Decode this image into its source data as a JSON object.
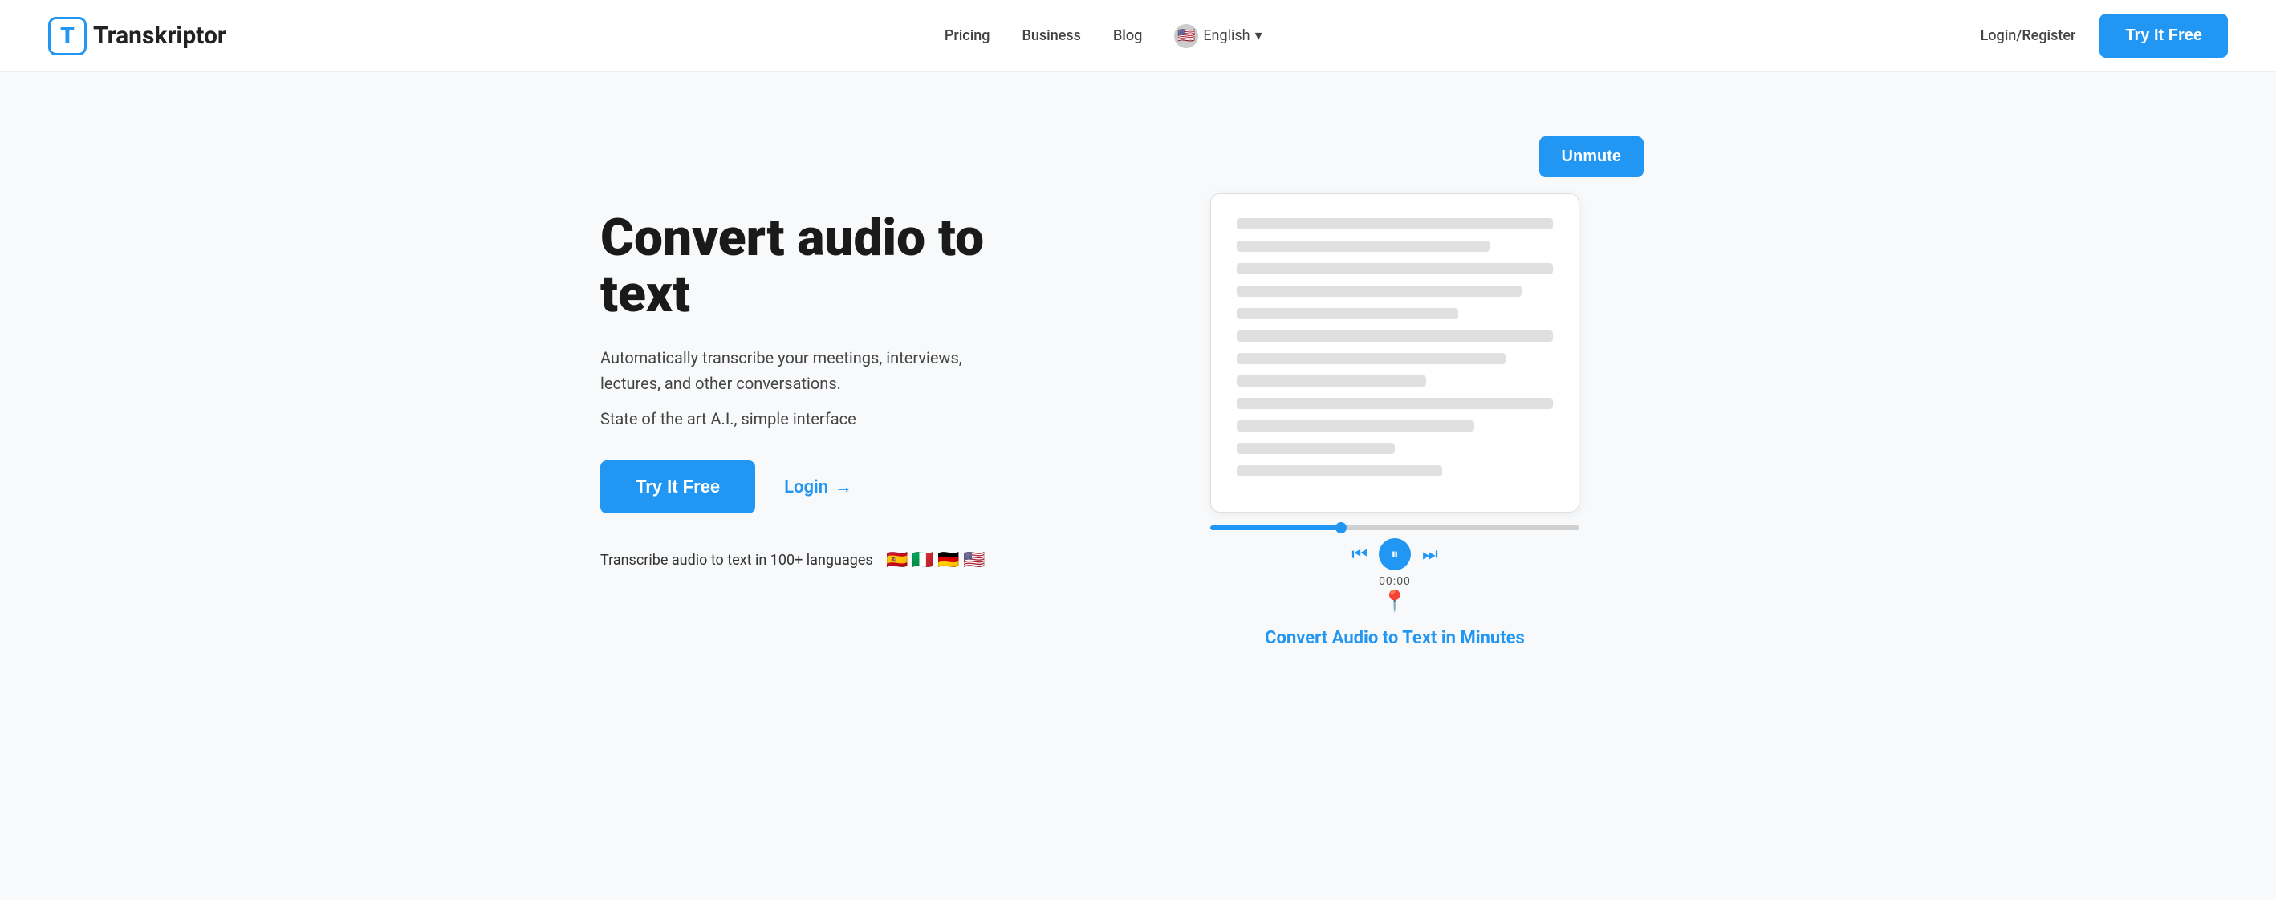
{
  "nav": {
    "logo_letter": "T",
    "logo_name_prefix": "",
    "logo_name": "Transkriptor",
    "links": [
      {
        "label": "Pricing",
        "id": "pricing"
      },
      {
        "label": "Business",
        "id": "business"
      },
      {
        "label": "Blog",
        "id": "blog"
      }
    ],
    "language": {
      "flag": "🇺🇸",
      "label": "English",
      "chevron": "▾"
    },
    "login_label": "Login/Register",
    "cta_label": "Try It Free"
  },
  "hero": {
    "title": "Convert audio to text",
    "subtitle": "Automatically transcribe your meetings, interviews, lectures, and other conversations.",
    "tagline": "State of the art A.I., simple interface",
    "try_btn": "Try It Free",
    "login_btn": "Login",
    "login_arrow": "→",
    "languages_text": "Transcribe audio to text in 100+ languages",
    "language_flags": [
      "🇪🇸",
      "🇮🇹",
      "🇩🇪",
      "🇺🇸"
    ],
    "unmute_btn": "Unmute",
    "demo_caption": "Convert Audio to Text in Minutes",
    "time_display": "00:00",
    "text_lines": [
      "w-full",
      "w-80",
      "w-full",
      "w-90",
      "w-70",
      "w-full",
      "w-85",
      "w-60",
      "w-full",
      "w-75",
      "w-50",
      "w-65",
      "w-45"
    ]
  }
}
